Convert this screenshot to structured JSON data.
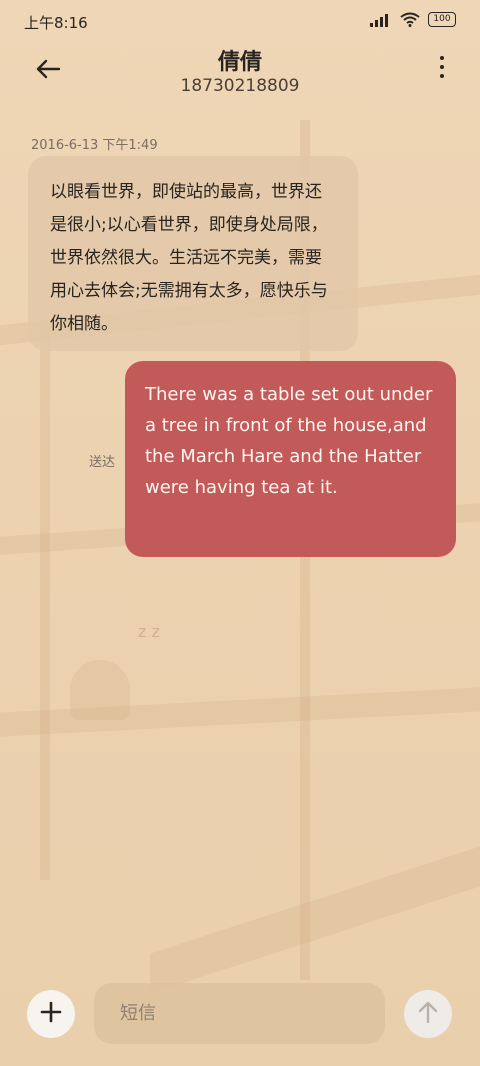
{
  "status_bar": {
    "time": "上午8:16",
    "battery": "100"
  },
  "header": {
    "contact_name": "倩倩",
    "contact_number": "18730218809"
  },
  "conversation": {
    "timestamp": "2016-6-13 下午1:49",
    "incoming_message": "以眼看世界，即使站的最高，世界还是很小;以心看世界，即使身处局限，世界依然很大。生活远不完美，需要用心去体会;无需拥有太多，愿快乐与你相随。",
    "outgoing_message": "There was a table set out under a tree in front of the house,and the March Hare and the Hatter were having tea at it.",
    "delivery_status": "送达"
  },
  "composer": {
    "placeholder": "短信"
  },
  "colors": {
    "background": "#ecd2b0",
    "outgoing_bubble": "#c35a5a",
    "incoming_bubble": "#e2c8a8"
  },
  "icons": {
    "back": "arrow-left-icon",
    "more": "more-vertical-icon",
    "add": "plus-icon",
    "send": "arrow-up-icon"
  }
}
